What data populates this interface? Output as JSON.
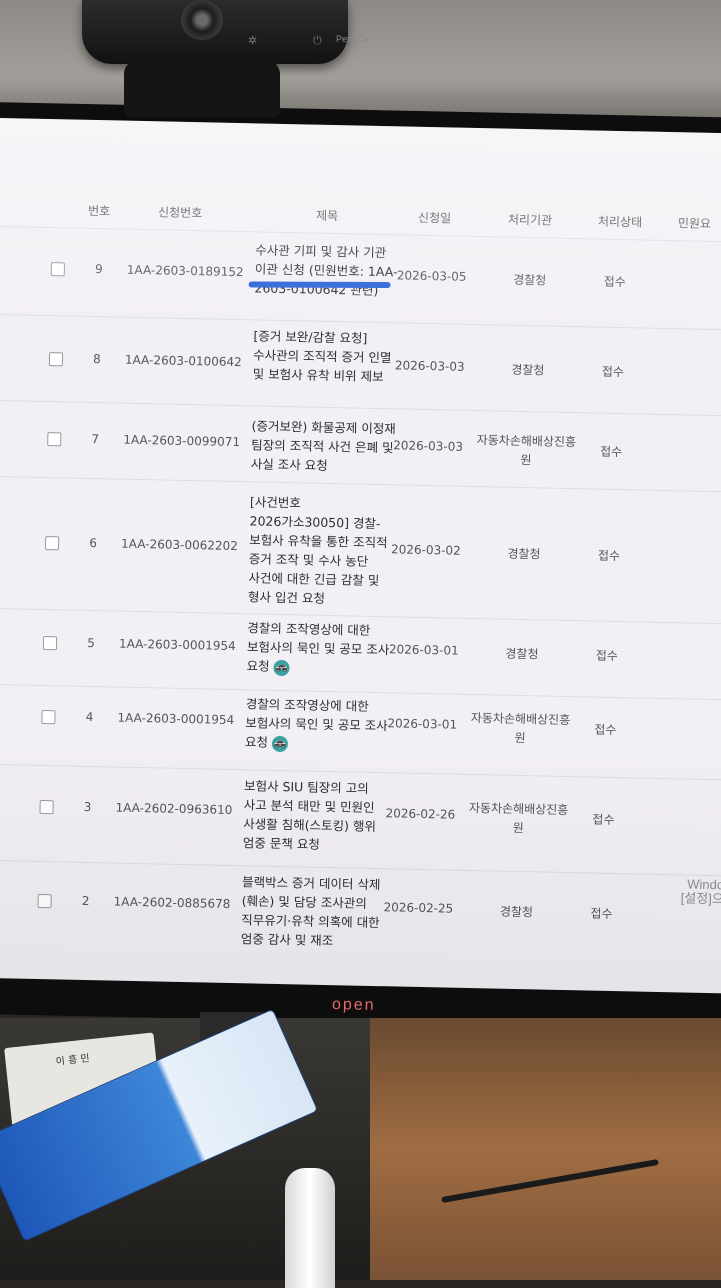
{
  "webcam": {
    "brand": "PengCa"
  },
  "monitor": {
    "logo": "uədo"
  },
  "desk": {
    "card_text": "이 흥 민"
  },
  "table": {
    "headers": {
      "num": "번호",
      "appno": "신청번호",
      "title": "제목",
      "date": "신청일",
      "agency": "처리기관",
      "status": "처리상태",
      "extra": "민원요"
    },
    "rows": [
      {
        "num": "9",
        "appno": "1AA-2603-0189152",
        "title": "수사관 기피 및 감사 기관 이관 신청 (민원번호: 1AA-2603-0100642 관련)",
        "date": "2026-03-05",
        "agency": "경찰청",
        "status": "접수",
        "highlight": "1AA-2603-0100642"
      },
      {
        "num": "8",
        "appno": "1AA-2603-0100642",
        "title": "[증거 보완/감찰 요청] 수사관의 조직적 증거 인멸 및 보험사 유착 비위 제보",
        "date": "2026-03-03",
        "agency": "경찰청",
        "status": "접수"
      },
      {
        "num": "7",
        "appno": "1AA-2603-0099071",
        "title": "(증거보완) 화물공제 이정재 팀장의 조직적 사건 은폐 및 사실 조사 요청",
        "date": "2026-03-03",
        "agency": "자동차손해배상진흥원",
        "status": "접수"
      },
      {
        "num": "6",
        "appno": "1AA-2603-0062202",
        "title": "[사건번호 2026가소30050] 경찰-보험사 유착을 통한 조직적 증거 조작 및 수사 농단 사건에 대한 긴급 감찰 및 형사 입건 요청",
        "date": "2026-03-02",
        "agency": "경찰청",
        "status": "접수"
      },
      {
        "num": "5",
        "appno": "1AA-2603-0001954",
        "title": "경찰의 조작영상에 대한 보험사의 묵인 및 공모 조사 요청",
        "date": "2026-03-01",
        "agency": "경찰청",
        "status": "접수",
        "badge": "🚓"
      },
      {
        "num": "4",
        "appno": "1AA-2603-0001954",
        "title": "경찰의 조작영상에 대한 보험사의 묵인 및 공모 조사 요청",
        "date": "2026-03-01",
        "agency": "자동차손해배상진흥원",
        "status": "접수",
        "badge": "🚓"
      },
      {
        "num": "3",
        "appno": "1AA-2602-0963610",
        "title": "보험사 SIU 팀장의 고의 사고 분석 태만 및 민원인 사생활 침해(스토킹) 행위 엄중 문책 요청",
        "date": "2026-02-26",
        "agency": "자동차손해배상진흥원",
        "status": "접수"
      },
      {
        "num": "2",
        "appno": "1AA-2602-0885678",
        "title": "블랙박스 증거 데이터 삭제(훼손) 및 담당 조사관의 직무유기·유착 의혹에 대한 엄중 감사 및 재조",
        "date": "2026-02-25",
        "agency": "경찰청",
        "status": "접수"
      }
    ]
  },
  "watermark": {
    "line1": "Windo",
    "line2": "[설정]으"
  }
}
